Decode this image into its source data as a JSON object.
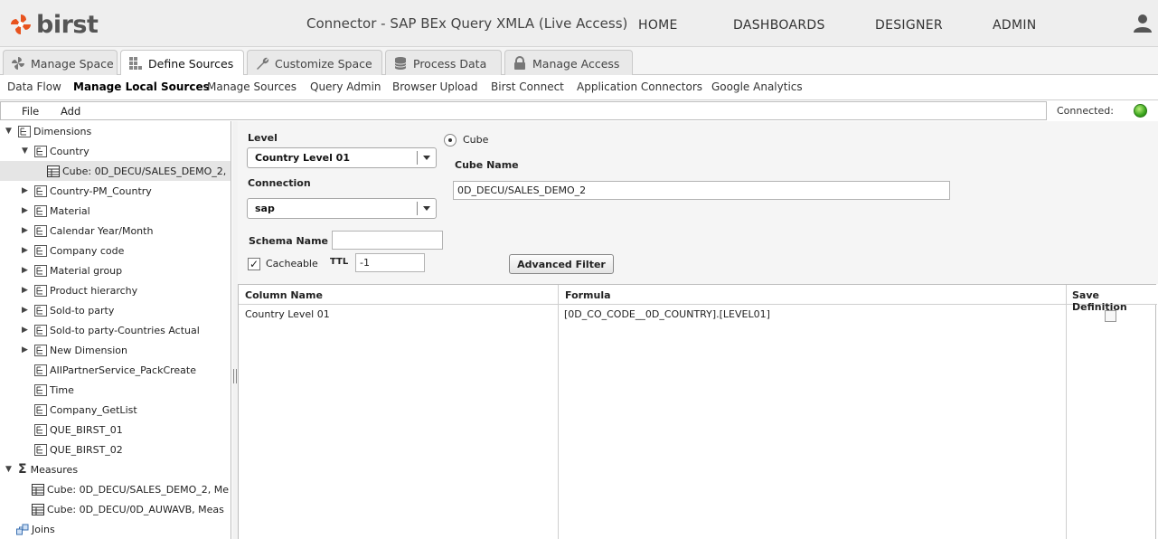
{
  "header": {
    "logo_text": "birst",
    "title": "Connector - SAP BEx Query XMLA (Live Access)",
    "nav": [
      "HOME",
      "DASHBOARDS",
      "DESIGNER",
      "ADMIN"
    ],
    "user_icon": "user-icon"
  },
  "tabs": [
    {
      "label": "Manage Space",
      "icon": "pinwheel-icon"
    },
    {
      "label": "Define Sources",
      "icon": "grid-icon",
      "active": true
    },
    {
      "label": "Customize Space",
      "icon": "wrench-icon"
    },
    {
      "label": "Process Data",
      "icon": "database-icon"
    },
    {
      "label": "Manage Access",
      "icon": "lock-icon"
    }
  ],
  "subnav": [
    "Data Flow",
    "Manage Local Sources",
    "Manage Sources",
    "Query Admin",
    "Browser Upload",
    "Birst Connect",
    "Application Connectors",
    "Google Analytics"
  ],
  "subnav_active": "Manage Local Sources",
  "menubar": {
    "file": "File",
    "add": "Add",
    "connected_label": "Connected:",
    "status_color": "#3aa41d"
  },
  "tree": {
    "dimensions_label": "Dimensions",
    "items": [
      {
        "label": "Country",
        "expanded": true
      },
      {
        "label": "Cube: 0D_DECU/SALES_DEMO_2,",
        "type": "cube",
        "selected": true
      },
      {
        "label": "Country-PM_Country"
      },
      {
        "label": "Material"
      },
      {
        "label": "Calendar Year/Month"
      },
      {
        "label": "Company code"
      },
      {
        "label": "Material group"
      },
      {
        "label": "Product hierarchy"
      },
      {
        "label": "Sold-to party"
      },
      {
        "label": "Sold-to party-Countries Actual"
      },
      {
        "label": "New Dimension"
      },
      {
        "label": "AIIPartnerService_PackCreate",
        "leaf": true
      },
      {
        "label": "Time",
        "leaf": true
      },
      {
        "label": "Company_GetList",
        "leaf": true
      },
      {
        "label": "QUE_BIRST_01",
        "leaf": true
      },
      {
        "label": "QUE_BIRST_02",
        "leaf": true
      }
    ],
    "measures_label": "Measures",
    "measures": [
      {
        "label": "Cube: 0D_DECU/SALES_DEMO_2, Me"
      },
      {
        "label": "Cube: 0D_DECU/0D_AUWAVB, Meas"
      }
    ],
    "joins_label": "Joins"
  },
  "form": {
    "level_label": "Level",
    "level_value": "Country Level 01",
    "connection_label": "Connection",
    "connection_value": "sap",
    "cube_radio_label": "Cube",
    "cube_name_label": "Cube Name",
    "cube_name_value": "0D_DECU/SALES_DEMO_2",
    "schema_name_label": "Schema Name",
    "schema_name_value": "",
    "cacheable_label": "Cacheable",
    "cacheable_checked": true,
    "ttl_label": "TTL",
    "ttl_value": "-1",
    "advanced_filter_label": "Advanced Filter"
  },
  "grid": {
    "columns": [
      "Column Name",
      "Formula",
      "Save Definition"
    ],
    "rows": [
      {
        "column_name": "Country Level 01",
        "formula": "[0D_CO_CODE__0D_COUNTRY].[LEVEL01]",
        "save_definition": false
      }
    ]
  }
}
